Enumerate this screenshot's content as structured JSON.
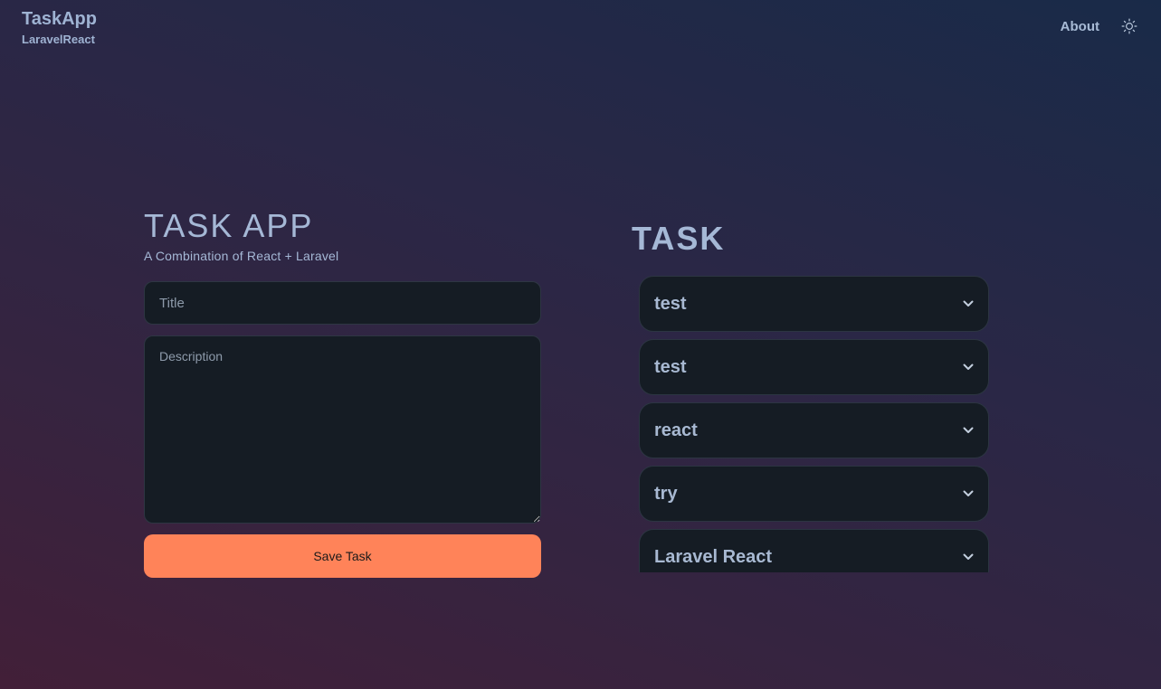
{
  "header": {
    "brand_title": "TaskApp",
    "brand_subtitle": "LaravelReact",
    "about_label": "About",
    "theme_icon": "sun-icon"
  },
  "form": {
    "title": "TASK APP",
    "subtitle": "A Combination of React + Laravel",
    "title_placeholder": "Title",
    "title_value": "",
    "description_placeholder": "Description",
    "description_value": "",
    "save_label": "Save Task"
  },
  "tasks": {
    "heading": "TASK",
    "items": [
      {
        "label": "test",
        "icon": "chevron-down-icon"
      },
      {
        "label": "test",
        "icon": "chevron-down-icon"
      },
      {
        "label": "react",
        "icon": "chevron-down-icon"
      },
      {
        "label": "try",
        "icon": "chevron-down-icon"
      },
      {
        "label": "Laravel React",
        "icon": "chevron-down-icon"
      }
    ]
  },
  "colors": {
    "accent": "#ff8359",
    "card_background": "#151c24",
    "text": "#a8b9d2"
  }
}
